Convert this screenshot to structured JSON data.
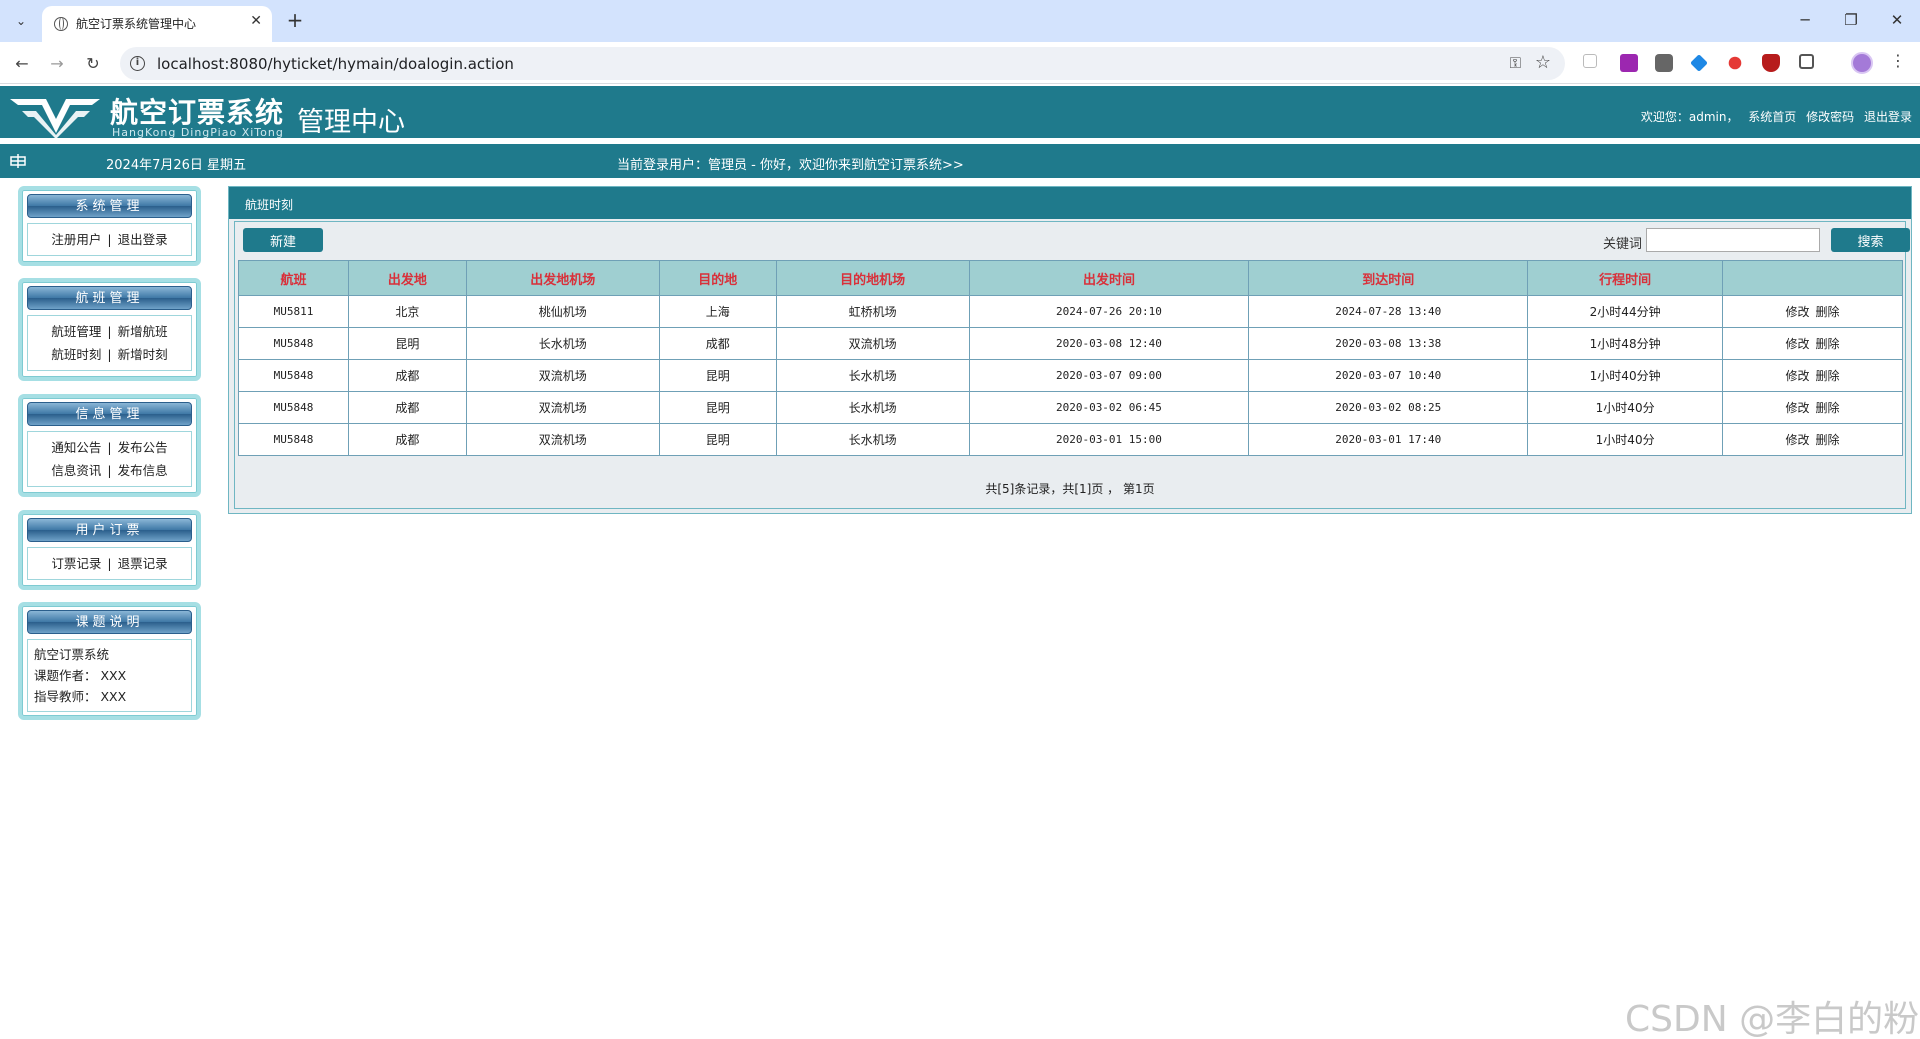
{
  "browser": {
    "tab_title": "航空订票系统管理中心",
    "url": "localhost:8080/hyticket/hymain/doalogin.action"
  },
  "header": {
    "logo_title": "航空订票系统",
    "logo_pinyin": "HangKong DingPiao XiTong",
    "logo_sub": "管理中心",
    "welcome_user": "欢迎您：admin，",
    "link_home": "系统首页",
    "link_change_pwd": "修改密码",
    "link_logout": "退出登录"
  },
  "info_bar": {
    "date": "2024年7月26日 星期五",
    "welcome": "当前登录用户：管理员 - 你好，欢迎你来到航空订票系统>>"
  },
  "sidebar": {
    "system": {
      "title": "系统管理",
      "items": [
        "注册用户",
        "退出登录"
      ]
    },
    "flights": {
      "title": "航班管理",
      "items": [
        "航班管理",
        "新增航班",
        "航班时刻",
        "新增时刻"
      ]
    },
    "info": {
      "title": "信息管理",
      "items": [
        "通知公告",
        "发布公告",
        "信息资讯",
        "发布信息"
      ]
    },
    "tickets": {
      "title": "用户订票",
      "items": [
        "订票记录",
        "退票记录"
      ]
    },
    "about": {
      "title": "课题说明",
      "lines": [
        "航空订票系统",
        "课题作者：  XXX",
        "指导教师：  XXX"
      ]
    }
  },
  "main": {
    "panel_title": "航班时刻",
    "new_button": "新建",
    "keyword_label": "关键词",
    "search_button": "搜索",
    "columns": [
      "航班",
      "出发地",
      "出发地机场",
      "目的地",
      "目的地机场",
      "出发时间",
      "到达时间",
      "行程时间",
      ""
    ],
    "rows": [
      [
        "MU5811",
        "北京",
        "桃仙机场",
        "上海",
        "虹桥机场",
        "2024-07-26 20:10",
        "2024-07-28 13:40",
        "2小时44分钟"
      ],
      [
        "MU5848",
        "昆明",
        "长水机场",
        "成都",
        "双流机场",
        "2020-03-08 12:40",
        "2020-03-08 13:38",
        "1小时48分钟"
      ],
      [
        "MU5848",
        "成都",
        "双流机场",
        "昆明",
        "长水机场",
        "2020-03-07 09:00",
        "2020-03-07 10:40",
        "1小时40分钟"
      ],
      [
        "MU5848",
        "成都",
        "双流机场",
        "昆明",
        "长水机场",
        "2020-03-02 06:45",
        "2020-03-02 08:25",
        "1小时40分"
      ],
      [
        "MU5848",
        "成都",
        "双流机场",
        "昆明",
        "长水机场",
        "2020-03-01 15:00",
        "2020-03-01 17:40",
        "1小时40分"
      ]
    ],
    "action_edit": "修改",
    "action_delete": "删除",
    "pager": "共[5]条记录，共[1]页 ， 第1页"
  },
  "watermark": "CSDN @李白的粉",
  "colors": {
    "header_teal": "#1f7a8c",
    "table_header_bg": "#9fcfd1",
    "table_header_text": "#d9303a"
  }
}
